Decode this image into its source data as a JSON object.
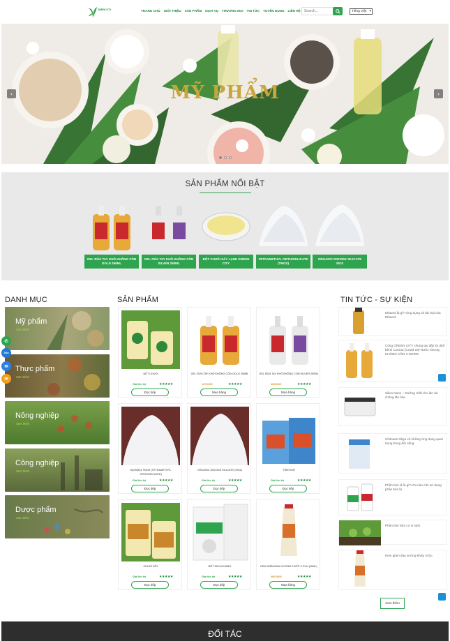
{
  "header": {
    "logo_text": "GREEN CITY",
    "nav": [
      "TRANG CHỦ",
      "GIỚI THIỆU",
      "SẢN PHẨM",
      "DỊCH VỤ",
      "THƯƠNG MẠI",
      "TIN TỨC",
      "TUYỂN DỤNG",
      "LIÊN HỆ"
    ],
    "search_placeholder": "Search...",
    "language": "Tiếng Việt"
  },
  "banner": {
    "title": "MỸ PHẨM",
    "slide_count": 3,
    "active_slide": 1
  },
  "featured": {
    "title": "SẢN PHẨM NỔI BẬT",
    "items": [
      "GEL RỬA TAY KHÔ KHÔNG CỒN GOLD 250ML",
      "GEL RỬA TAY KHÔ KHÔNG CỒN SILVER 250ML",
      "BỘT CHUỐI SẤY LẠNH GREEN CITY",
      "TETRAMETHYL ORTHOSILICATE (TMOS)",
      "ORGANIC DIOXIDE SILICATE SIO2"
    ]
  },
  "categories": {
    "title": "DANH MỤC",
    "more_label": "Xem thêm",
    "items": [
      "Mỹ phẩm",
      "Thực phẩm",
      "Nông nghiệp",
      "Công nghiệp",
      "Dược phẩm"
    ]
  },
  "products": {
    "title": "SẢN PHẨM",
    "items": [
      {
        "name": "BỘT CHUỐI",
        "price": "Giá liên hệ",
        "button": "Đọc tiếp"
      },
      {
        "name": "GEL RỬA TAY KHÔ KHÔNG CỒN GOLD 250ML",
        "price": "127.000₫",
        "button": "Mua hàng"
      },
      {
        "name": "GEL RỬA TAY KHÔ KHÔNG CỒN SILVER 250ML",
        "price": "115.000₫",
        "button": "Mua hàng"
      },
      {
        "name": "SI(OME)4 TMOS (TETRAMETHYL ORTHOSILICATE)",
        "price": "Giá liên hệ",
        "button": "Đọc tiếp"
      },
      {
        "name": "ORGANIC DIOXIDE SILICATE (SIO2)",
        "price": "Giá liên hệ",
        "button": "Đọc tiếp"
      },
      {
        "name": "TÔM KHÔ",
        "price": "Giá liên hệ",
        "button": "Đọc tiếp"
      },
      {
        "name": "CHUỐI SẤY",
        "price": "Giá liên hệ",
        "button": "Đọc tiếp"
      },
      {
        "name": "BỘT SILICA NANO",
        "price": "Giá liên hệ",
        "button": "Đọc tiếp"
      },
      {
        "name": "KEM GIẢM ĐAU XƯƠNG KHỚP V-GLU (30ML)",
        "price": "490.000₫",
        "button": "Mua hàng"
      }
    ],
    "stars": "★★★★★"
  },
  "news": {
    "title": "TIN TỨC - SỰ KIỆN",
    "items": [
      "Ethanol là gì? Ứng dụng và tác hại của Ethanol",
      "Cùng GREEN CITY chung tay đẩy lùi dịch bệnh Corona (Covid-19)-Nước rửa tay KHÔNG CỒN V-GERM",
      "Silica Nano – Dưỡng chất cho làn da chống lão hóa",
      "Chitosan Oligo và những ứng dụng quan trọng trong đời sống",
      "Phân bón lá là gì? Khi nào cần sử dụng phân bón lá",
      "Phân bón hữu cơ vi sinh",
      "Kem giảm đau xương khớp VGlu"
    ],
    "more_button": "Xem thêm"
  },
  "partners": {
    "title": "ĐỐI TÁC"
  },
  "floating": {
    "zalo_label": "Zalo"
  },
  "colors": {
    "brand_green": "#2ea44f",
    "dark_green": "#1f8a3b",
    "price_orange": "#e58a1f"
  }
}
